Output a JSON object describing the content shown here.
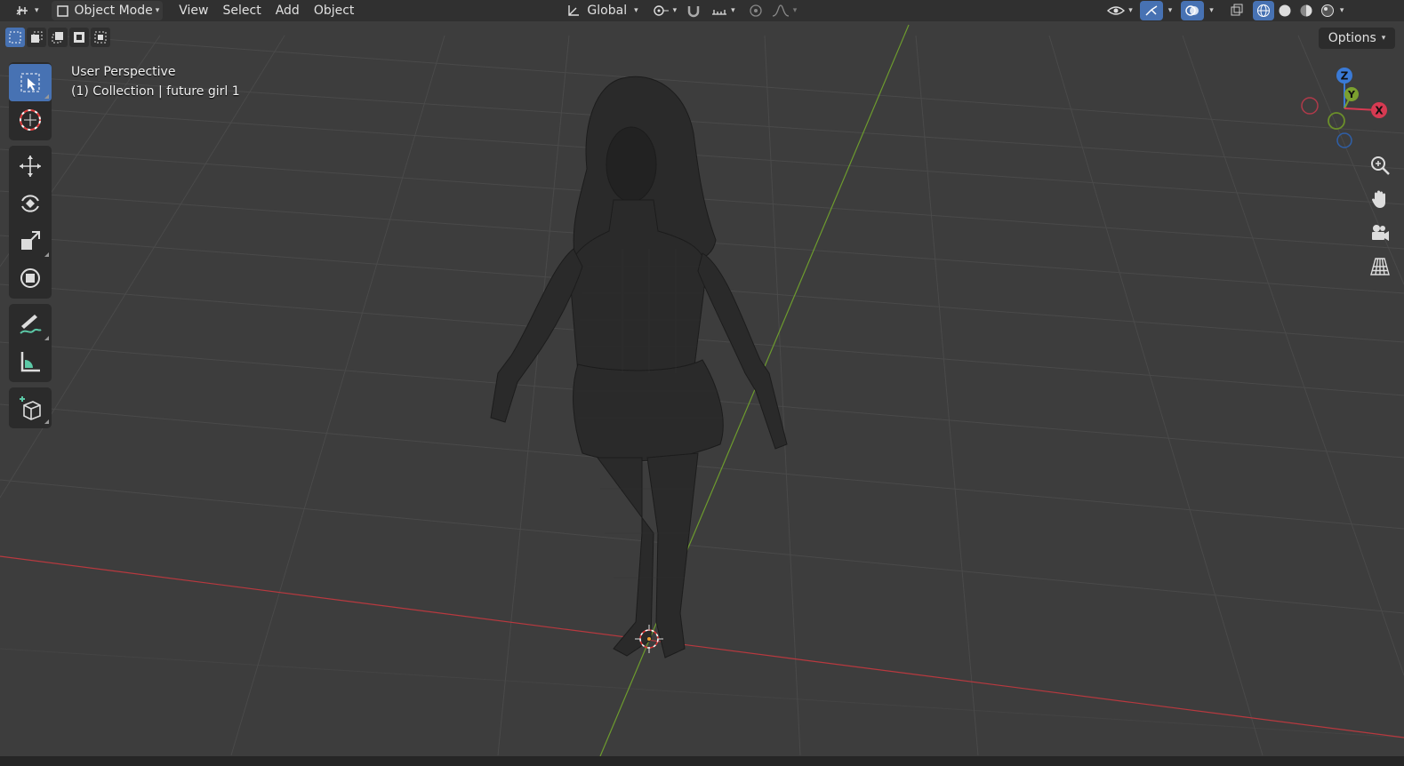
{
  "header": {
    "mode_label": "Object Mode",
    "menus": [
      "View",
      "Select",
      "Add",
      "Object"
    ],
    "transform_orientation": "Global",
    "options_label": "Options"
  },
  "viewport": {
    "perspective_label": "User Perspective",
    "collection_label": "(1) Collection | future girl 1"
  },
  "gizmo": {
    "z_label": "Z",
    "y_label": "Y",
    "x_label": "X",
    "colors": {
      "x": "#d63a52",
      "y": "#7ba02f",
      "z": "#3a7ad6"
    }
  },
  "colors": {
    "accent": "#4772b3",
    "x_axis_line": "#b8393f",
    "y_axis_line": "#6d9b2e",
    "grid": "#4a4a4a",
    "background": "#3d3d3d"
  },
  "icons": {
    "toolbar": [
      "select-box-icon",
      "cursor-icon",
      "move-icon",
      "rotate-icon",
      "scale-icon",
      "transform-icon",
      "annotate-icon",
      "measure-icon",
      "add-cube-icon"
    ],
    "nav": [
      "zoom-icon",
      "pan-hand-icon",
      "camera-icon",
      "grid-view-icon"
    ]
  }
}
